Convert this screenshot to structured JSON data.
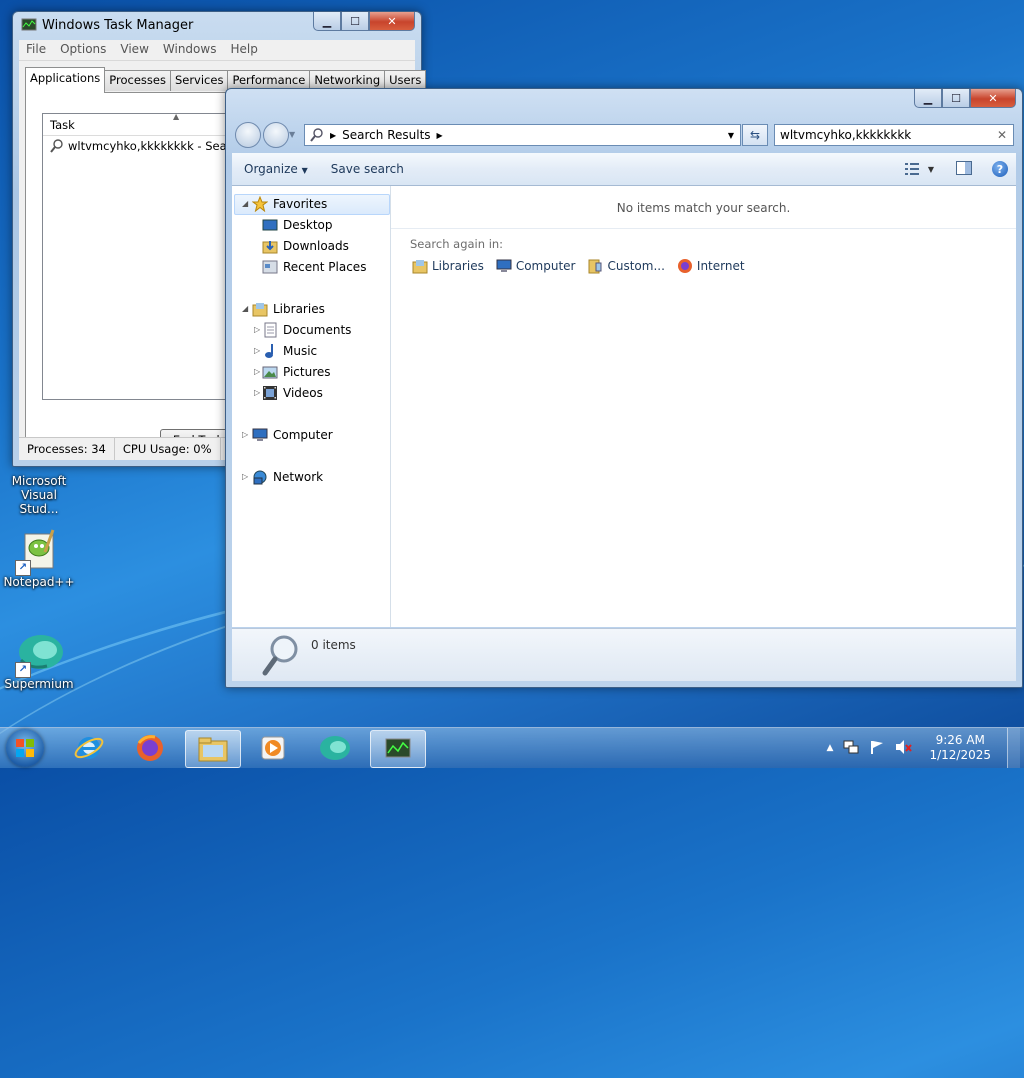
{
  "desktop": {
    "icons": [
      {
        "label_line1": "Microsoft",
        "label_line2": "Visual Stud..."
      },
      {
        "label": "Notepad++"
      },
      {
        "label": "Supermium"
      }
    ]
  },
  "task_manager": {
    "title": "Windows Task Manager",
    "menu": [
      "File",
      "Options",
      "View",
      "Windows",
      "Help"
    ],
    "tabs": [
      "Applications",
      "Processes",
      "Services",
      "Performance",
      "Networking",
      "Users"
    ],
    "active_tab": "Applications",
    "list_header": "Task",
    "tasks": [
      "wltvmcyhko,kkkkkkkk - Search Re"
    ],
    "end_task_label": "End Task",
    "status": {
      "processes": "Processes: 34",
      "cpu": "CPU Usage: 0%"
    }
  },
  "explorer": {
    "address_label": "Search Results",
    "search_value": "wltvmcyhko,kkkkkkkk",
    "toolbar": {
      "organize": "Organize",
      "save_search": "Save search"
    },
    "nav": {
      "favorites": "Favorites",
      "favorites_items": [
        "Desktop",
        "Downloads",
        "Recent Places"
      ],
      "libraries": "Libraries",
      "libraries_items": [
        "Documents",
        "Music",
        "Pictures",
        "Videos"
      ],
      "computer": "Computer",
      "network": "Network"
    },
    "content": {
      "empty_message": "No items match your search.",
      "search_again_label": "Search again in:",
      "search_again_items": [
        "Libraries",
        "Computer",
        "Custom...",
        "Internet"
      ]
    },
    "details": {
      "count": "0 items"
    }
  },
  "taskbar": {
    "clock_time": "9:26 AM",
    "clock_date": "1/12/2025"
  }
}
